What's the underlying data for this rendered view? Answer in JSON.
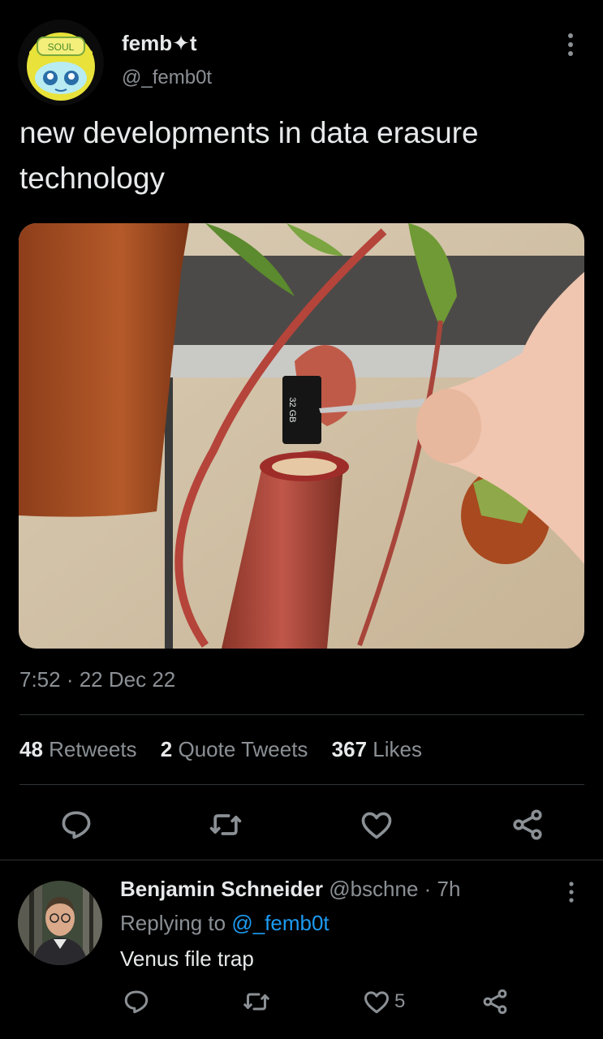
{
  "colors": {
    "background": "#000000",
    "text": "#e7e9ea",
    "muted": "#8b9095",
    "accent": "#1d9bf0"
  },
  "tweet": {
    "display_name": "femb✦t",
    "handle": "@_femb0t",
    "text": "new developments in data erasure technology",
    "timestamp": "7:52 · 22 Dec 22",
    "avatar_icon": "soul-helmet-avatar",
    "avatar_text": "SOUL",
    "media_icon": "photo-pitcher-plant-sd-card",
    "sd_card_label": "32 GB"
  },
  "stats": {
    "retweets_count": "48",
    "retweets_label": "Retweets",
    "quotes_count": "2",
    "quotes_label": "Quote Tweets",
    "likes_count": "367",
    "likes_label": "Likes"
  },
  "actions": [
    "reply-icon",
    "retweet-icon",
    "like-icon",
    "share-icon"
  ],
  "reply": {
    "name": "Benjamin Schneider",
    "meta": "@bschne · 7h",
    "replying_prefix": "Replying to",
    "replying_to": "@_femb0t",
    "text": "Venus file trap",
    "like_count": "5"
  }
}
